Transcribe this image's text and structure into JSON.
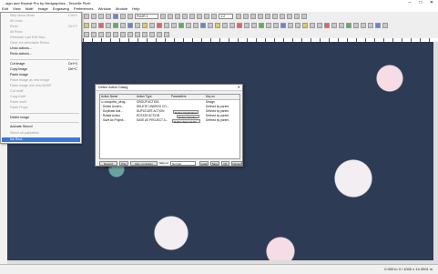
{
  "window": {
    "title": "...sign and Repeat Pro by Nedgraphics - Texcelle Pixel",
    "minimize": "–",
    "maximize": "□",
    "close": "✕"
  },
  "menubar": [
    "Edit",
    "View",
    "Motif",
    "Image",
    "Engraving",
    "Preferences",
    "Window",
    "Module",
    "Help"
  ],
  "toolbar": {
    "layer_combo": "RU4R 1",
    "zoom_field": "1:2"
  },
  "menu": {
    "items": [
      {
        "label": "Step Move Mode",
        "shortcut": "Ctrl+Z",
        "disabled": true
      },
      {
        "label": "All Undo",
        "shortcut": "",
        "disabled": true
      },
      {
        "label": "Redo",
        "shortcut": "Ctrl+Y",
        "disabled": true
      },
      {
        "label": "All Redo",
        "shortcut": "",
        "disabled": true
      },
      {
        "label": "Reinstate Last Edit Step",
        "shortcut": "",
        "disabled": true
      },
      {
        "label": "Clear the selectable Redos",
        "shortcut": "",
        "disabled": true
      },
      {
        "label": "Undo actions...",
        "shortcut": "",
        "disabled": false
      },
      {
        "label": "Redo actions...",
        "shortcut": "",
        "disabled": false
      },
      {
        "label": "Cut image",
        "shortcut": "Ctrl+X",
        "disabled": false
      },
      {
        "label": "Copy image",
        "shortcut": "Ctrl+C",
        "disabled": false
      },
      {
        "label": "Paste image",
        "shortcut": "",
        "disabled": false
      },
      {
        "label": "Paste image as new Image",
        "shortcut": "",
        "disabled": true
      },
      {
        "label": "Paste image into new AMAP",
        "shortcut": "",
        "disabled": true
      },
      {
        "label": "Cut motif",
        "shortcut": "",
        "disabled": true
      },
      {
        "label": "Copy motif",
        "shortcut": "",
        "disabled": true
      },
      {
        "label": "Paste motif",
        "shortcut": "",
        "disabled": true
      },
      {
        "label": "Paste Props",
        "shortcut": "",
        "disabled": true
      },
      {
        "label": "Delete image",
        "shortcut": "",
        "disabled": false
      },
      {
        "label": "Activate Stencil",
        "shortcut": "",
        "disabled": false
      },
      {
        "label": "Select all paintables",
        "shortcut": "",
        "disabled": true
      },
      {
        "label": "Ins Rect...",
        "shortcut": "",
        "disabled": false,
        "highlight": true
      }
    ]
  },
  "dialog": {
    "title": "Define Action Dialog",
    "close": "✕",
    "columns": [
      "Action Name",
      "Action Type",
      "Parameters",
      "Key on"
    ],
    "rows": [
      {
        "name": "⊟ canvprtsv_ufrog...",
        "type": "GROUP ACTION",
        "param": "",
        "key": "Design"
      },
      {
        "name": "  · Delete Underc...",
        "type": "DELETE UNDEDO CO...",
        "param": "",
        "key": "Defined by parent"
      },
      {
        "name": "  · Duplicate Acti...",
        "type": "DUPLICATE ACTION",
        "param": "Define Duplication",
        "key": "Defined by parent"
      },
      {
        "name": "  · Rotate Action",
        "type": "ROTATE ACTION",
        "param": "Define Rotation",
        "key": "Defined by parent"
      },
      {
        "name": "  · Save As Project...",
        "type": "SAVE AS PROJECT A...",
        "param": "Define Save As Pr...",
        "key": "Defined by parent"
      }
    ],
    "buttons": [
      "Record Action",
      "Play",
      "Rec. on Action Groups",
      "Skip on",
      "Normal",
      "Load",
      "Save",
      "OK",
      "Cancel"
    ]
  },
  "status": {
    "coords": "0.000 in   3 / 1000 x 14.3001 in"
  }
}
